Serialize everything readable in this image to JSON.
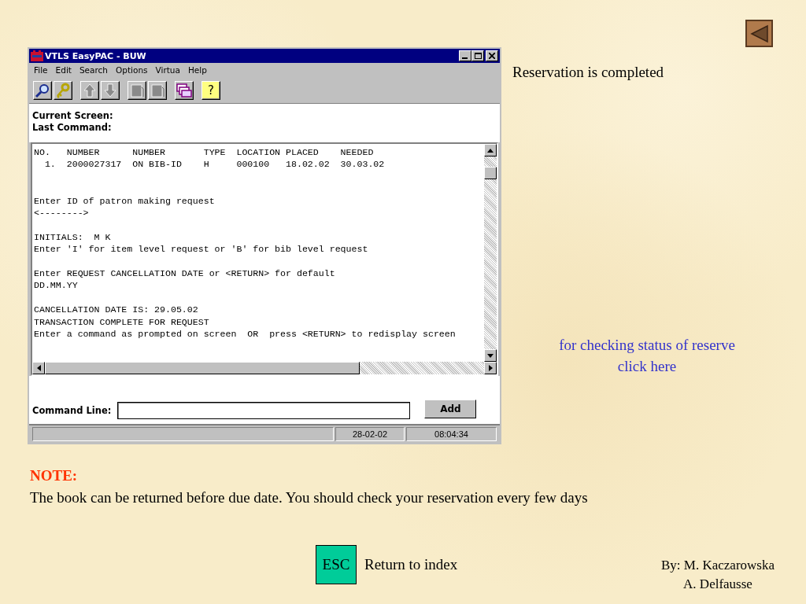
{
  "back_button": {
    "kind": "previous"
  },
  "window": {
    "title": "VTLS EasyPAC - BUW",
    "menu": [
      "File",
      "Edit",
      "Search",
      "Options",
      "Virtua",
      "Help"
    ],
    "toolbar": [
      {
        "kind": "search"
      },
      {
        "kind": "key"
      },
      {
        "kind": "up"
      },
      {
        "kind": "down"
      },
      {
        "kind": "page"
      },
      {
        "kind": "page"
      },
      {
        "kind": "windows"
      },
      {
        "kind": "help",
        "label": "?"
      }
    ],
    "info": [
      "Current Screen:",
      "Last Command:"
    ],
    "terminal_blocks": [
      [
        "NO.   NUMBER      NUMBER       TYPE  LOCATION PLACED    NEEDED",
        "  1.  2000027317  ON BIB-ID    H     000100   18.02.02  30.03.02"
      ],
      [
        "Enter ID of patron making request",
        "<-------->"
      ],
      [
        "INITIALS:  M K",
        "Enter 'I' for item level request or 'B' for bib level request"
      ],
      [
        "Enter REQUEST CANCELLATION DATE or <RETURN> for default",
        "DD.MM.YY"
      ],
      [
        "CANCELLATION DATE IS: 29.05.02",
        "TRANSACTION COMPLETE FOR REQUEST",
        "Enter a command as prompted on screen  OR  press <RETURN> to redisplay screen"
      ]
    ],
    "command_line": {
      "label": "Command Line:",
      "button": "Add"
    },
    "status_bar": [
      "28-02-02",
      "08:04:34"
    ]
  },
  "caption": "Reservation is completed",
  "link": [
    "for checking status of reserve",
    "click here"
  ],
  "note": {
    "heading": "NOTE:",
    "text": "The book can be returned before due date. You should check your reservation every few days"
  },
  "esc": {
    "key": "ESC",
    "label": "Return to index"
  },
  "authors": [
    "By: M. Kaczarowska",
    "A. Delfausse"
  ]
}
